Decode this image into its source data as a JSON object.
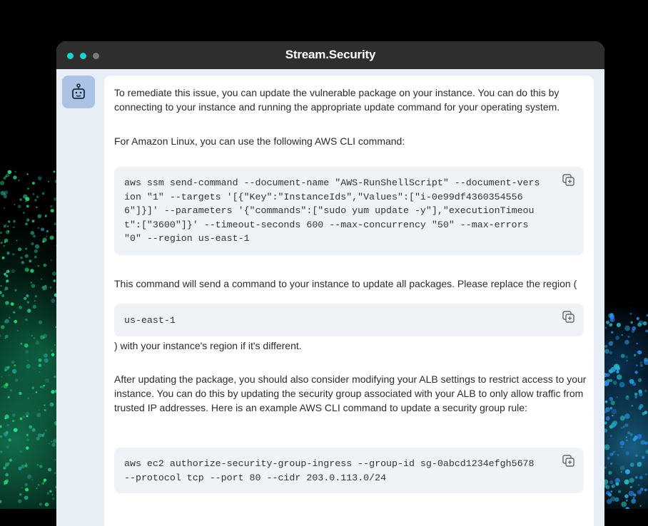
{
  "window": {
    "title": "Stream.Security",
    "controls": [
      {
        "name": "close",
        "color": "#1fd1d1"
      },
      {
        "name": "minimize",
        "color": "#1fd1d1"
      },
      {
        "name": "maximize",
        "color": "#7a7a7a"
      }
    ]
  },
  "assistant": {
    "avatar_icon": "robot-icon"
  },
  "message": {
    "p1": "To remediate this issue, you can update the vulnerable package on your instance. You can do this by connecting to your instance and running the appropriate update command for your operating system.",
    "p2": "For Amazon Linux, you can use the following AWS CLI command:",
    "code1": "aws ssm send-command --document-name \"AWS-RunShellScript\" --document-version \"1\" --targets '[{\"Key\":\"InstanceIds\",\"Values\":[\"i-0e99df43603545566\"]}]' --parameters '{\"commands\":[\"sudo yum update -y\"],\"executionTimeout\":[\"3600\"]}' --timeout-seconds 600 --max-concurrency \"50\" --max-errors \"0\" --region us-east-1",
    "p3": "This command will send a command to your instance to update all packages. Please replace the region (",
    "code2": "us-east-1",
    "p4": ") with your instance's region if it's different.",
    "p5": "After updating the package, you should also consider modifying your ALB settings to restrict access to your instance. You can do this by updating the security group associated with your ALB to only allow traffic from trusted IP addresses. Here is an example AWS CLI command to update a security group rule:",
    "code3": "aws ec2 authorize-security-group-ingress --group-id sg-0abcd1234efgh5678 --protocol tcp --port 80 --cidr 203.0.113.0/24"
  },
  "icons": {
    "copy": "copy-icon"
  }
}
